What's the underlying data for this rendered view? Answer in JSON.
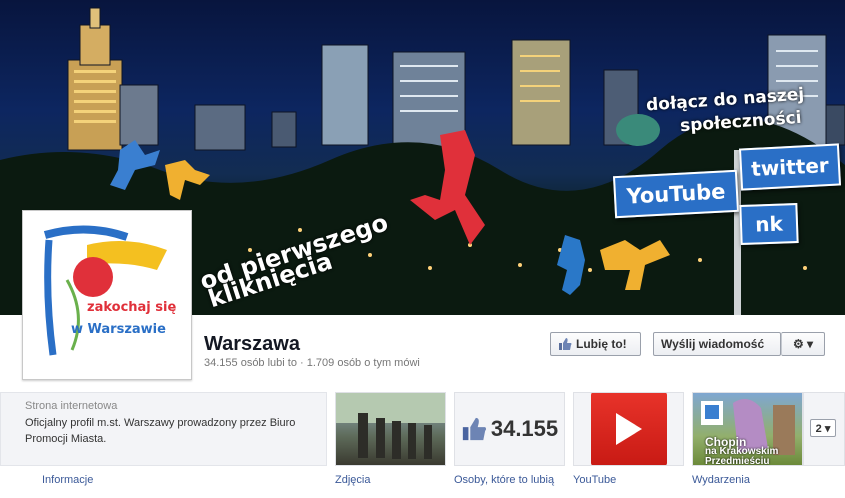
{
  "cover": {
    "join_line1": "dołącz do naszej",
    "join_line2": "społeczności",
    "click_line1": "od pierwszego",
    "click_line2": "kliknięcia",
    "signs": {
      "youtube": "YouTube",
      "twitter": "twitter",
      "nk": "nk"
    }
  },
  "profile": {
    "logo_text_line1": "zakochaj się",
    "logo_text_line2": "w Warszawie"
  },
  "page": {
    "name": "Warszawa",
    "stats": "34.155 osób lubi to · 1.709 osób o tym mówi"
  },
  "actions": {
    "like_label": "Lubię to!",
    "message_label": "Wyślij wiadomość",
    "gear_label": "⚙ ▾"
  },
  "info": {
    "label": "Strona internetowa",
    "text": "Oficjalny profil m.st. Warszawy prowadzony przez Biuro Promocji Miasta.",
    "link": "Informacje"
  },
  "apps": {
    "photos_label": "Zdjęcia",
    "likes_count": "34.155",
    "likes_label": "Osoby, które to lubią",
    "youtube_label": "YouTube",
    "events_label": "Wydarzenia",
    "events_caption1": "Chopin",
    "events_caption2": "na Krakowskim",
    "events_caption3": "Przedmieściu",
    "more_label": "2 ▾"
  },
  "colors": {
    "link": "#3b5998",
    "sign_blue": "#2a6fc6",
    "youtube_red": "#e8332a"
  }
}
